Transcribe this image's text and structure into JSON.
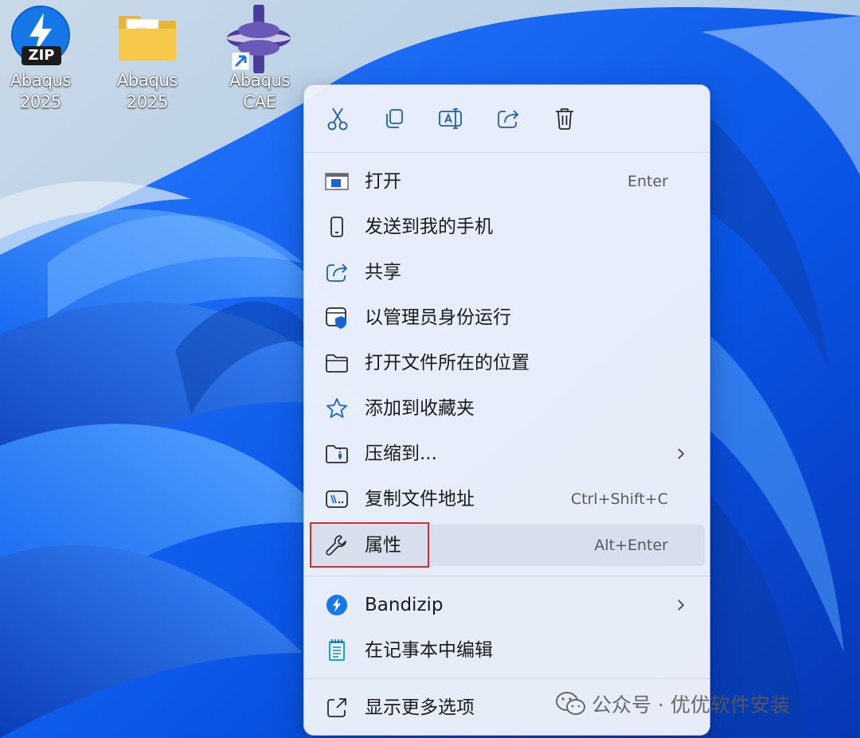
{
  "desktop": {
    "icons": [
      {
        "label": "Abaqus\n2025",
        "icon": "bandizip-zip-icon",
        "badge": "ZIP"
      },
      {
        "label": "Abaqus\n2025",
        "icon": "folder-icon"
      },
      {
        "label": "Abaqus CAE",
        "icon": "abaqus-cae-icon"
      }
    ]
  },
  "context_menu": {
    "toolbar": [
      {
        "name": "cut",
        "icon": "scissors-icon"
      },
      {
        "name": "copy",
        "icon": "copy-icon"
      },
      {
        "name": "rename",
        "icon": "rename-icon"
      },
      {
        "name": "share",
        "icon": "share-icon"
      },
      {
        "name": "delete",
        "icon": "trash-icon"
      }
    ],
    "items": [
      {
        "label": "打开",
        "shortcut": "Enter",
        "icon": "app-window-icon"
      },
      {
        "label": "发送到我的手机",
        "shortcut": "",
        "icon": "phone-icon"
      },
      {
        "label": "共享",
        "shortcut": "",
        "icon": "share-icon"
      },
      {
        "label": "以管理员身份运行",
        "shortcut": "",
        "icon": "shield-icon"
      },
      {
        "label": "打开文件所在的位置",
        "shortcut": "",
        "icon": "folder-icon"
      },
      {
        "label": "添加到收藏夹",
        "shortcut": "",
        "icon": "star-icon"
      },
      {
        "label": "压缩到...",
        "shortcut": "",
        "icon": "zip-folder-icon",
        "submenu": true
      },
      {
        "label": "复制文件地址",
        "shortcut": "Ctrl+Shift+C",
        "icon": "path-icon"
      },
      {
        "label": "属性",
        "shortcut": "Alt+Enter",
        "icon": "wrench-icon",
        "highlighted": true
      },
      {
        "label": "Bandizip",
        "shortcut": "",
        "icon": "bandizip-icon",
        "submenu": true
      },
      {
        "label": "在记事本中编辑",
        "shortcut": "",
        "icon": "notepad-icon"
      },
      {
        "label": "显示更多选项",
        "shortcut": "",
        "icon": "expand-icon"
      }
    ]
  },
  "watermark": {
    "text": "公众号 · 优优软件安装",
    "icon": "wechat-icon"
  },
  "colors": {
    "accent": "#0067c0",
    "highlight_box": "#e0272f"
  }
}
